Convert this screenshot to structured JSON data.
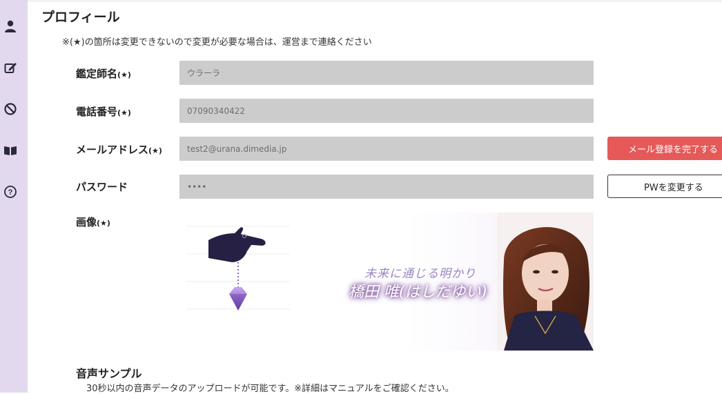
{
  "sidebar": {
    "items": [
      {
        "icon": "user-icon"
      },
      {
        "icon": "edit-icon"
      },
      {
        "icon": "block-icon"
      },
      {
        "icon": "book-icon"
      },
      {
        "icon": "help-icon"
      }
    ]
  },
  "page": {
    "title": "プロフィール",
    "notice": "※(★)の箇所は変更できないので変更が必要な場合は、運営まで連絡ください"
  },
  "form": {
    "name": {
      "label": "鑑定師名",
      "star": "(★)",
      "value": "ウラーラ"
    },
    "phone": {
      "label": "電話番号",
      "star": "(★)",
      "value": "07090340422"
    },
    "email": {
      "label": "メールアドレス",
      "star": "(★)",
      "value": "test2@urana.dimedia.jp"
    },
    "password": {
      "label": "パスワード",
      "value": "••••"
    },
    "image": {
      "label": "画像",
      "star": "(★)"
    }
  },
  "buttons": {
    "email_complete": "メール登録を完了する",
    "change_pw": "PWを変更する"
  },
  "banner": {
    "catchphrase": "未来に通じる明かり",
    "name": "橋田 唯(はしだゆい)"
  },
  "audio": {
    "title": "音声サンプル",
    "description": "30秒以内の音声データのアップロードが可能です。※詳細はマニュアルをご確認ください。"
  },
  "colors": {
    "sidebar_bg": "#e3d9ee",
    "field_bg": "#cccccc",
    "primary_red": "#e55959"
  }
}
